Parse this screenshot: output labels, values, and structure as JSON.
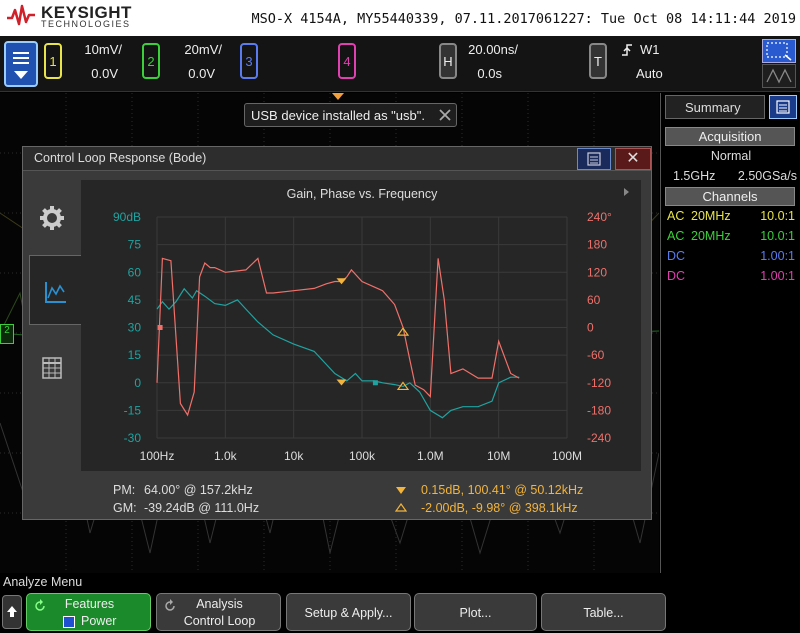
{
  "header": {
    "brand": "KEYSIGHT",
    "brand_sub": "TECHNOLOGIES",
    "instrument": "MSO-X 4154A, MY55440339, 07.11.2017061227: Tue Oct 08 14:11:44 2019"
  },
  "channels": [
    {
      "num": "1",
      "scale": "10mV/",
      "offset": "0.0V",
      "color": "#e8e44a"
    },
    {
      "num": "2",
      "scale": "20mV/",
      "offset": "0.0V",
      "color": "#3ccf3c"
    },
    {
      "num": "3",
      "color": "#5a7cf0"
    },
    {
      "num": "4",
      "color": "#e040b0"
    }
  ],
  "horizontal": {
    "key": "H",
    "scale": "20.00ns/",
    "offset": "0.0s"
  },
  "trigger": {
    "key": "T",
    "source": "W1",
    "mode": "Auto"
  },
  "toast": {
    "message": "USB device installed as \"usb\"."
  },
  "right_panel": {
    "title": "Summary",
    "acquisition_header": "Acquisition",
    "acquisition_mode": "Normal",
    "bandwidth": "1.5GHz",
    "sample_rate": "2.50GSa/s",
    "channels_header": "Channels",
    "channel_rows": [
      {
        "coupling": "AC",
        "bw": "20MHz",
        "probe": "10.0:1",
        "color": "#e8e44a"
      },
      {
        "coupling": "AC",
        "bw": "20MHz",
        "probe": "10.0:1",
        "color": "#3ccf3c"
      },
      {
        "coupling": "DC",
        "bw": "",
        "probe": "1.00:1",
        "color": "#5a7cf0"
      },
      {
        "coupling": "DC",
        "bw": "",
        "probe": "1.00:1",
        "color": "#e040b0"
      }
    ]
  },
  "ground_marker": "2",
  "dialog": {
    "title": "Control Loop Response (Bode)",
    "close_glyph": "✕"
  },
  "chart_data": {
    "type": "line",
    "title": "Gain, Phase vs. Frequency",
    "x_scale": "log",
    "x_ticks": [
      "100Hz",
      "1.0k",
      "10k",
      "100k",
      "1.0M",
      "10M",
      "100M"
    ],
    "y_left_ticks": [
      "90dB",
      "75",
      "60",
      "45",
      "30",
      "15",
      "0",
      "-15",
      "-30"
    ],
    "y_right_ticks": [
      "240°",
      "180",
      "120",
      "60",
      "0",
      "-60",
      "-120",
      "-180",
      "-240"
    ],
    "ylim_left": [
      -30,
      90
    ],
    "ylim_right": [
      -240,
      240
    ],
    "xlim_hz": [
      100,
      100000000
    ],
    "series": [
      {
        "name": "Gain",
        "axis": "left",
        "color": "#1fa3a0",
        "x": [
          100,
          120,
          150,
          190,
          250,
          330,
          380,
          500,
          700,
          1000,
          1500,
          2000,
          3000,
          5000,
          10000,
          20000,
          40000,
          60000,
          80000,
          100000,
          150000,
          200000,
          300000,
          400000,
          500000,
          700000,
          1000000,
          1500000,
          2000000,
          3000000,
          5000000,
          8000000,
          10000000,
          15000000,
          20000000
        ],
        "y": [
          40,
          44,
          40,
          44,
          51,
          46,
          50,
          47,
          43,
          42,
          45,
          40,
          33,
          26,
          21,
          17,
          5,
          1,
          5,
          1,
          1,
          0,
          -1,
          -2,
          0,
          -5,
          -15,
          -19,
          -15,
          -13,
          -13,
          -10,
          0,
          3,
          3
        ]
      },
      {
        "name": "Phase",
        "axis": "right",
        "color": "#f0706a",
        "x": [
          100,
          120,
          160,
          220,
          280,
          350,
          420,
          500,
          600,
          700,
          1000,
          2000,
          3000,
          4000,
          5000,
          10000,
          20000,
          30000,
          40000,
          50120,
          60000,
          70000,
          100000,
          200000,
          300000,
          400000,
          500000,
          600000,
          800000,
          1000000,
          1300000,
          1600000,
          2000000,
          3000000,
          5000000,
          8000000,
          10000000,
          15000000,
          20000000
        ],
        "y": [
          -120,
          150,
          145,
          -165,
          -190,
          -140,
          110,
          140,
          130,
          130,
          120,
          125,
          150,
          75,
          75,
          80,
          85,
          95,
          100,
          100,
          110,
          125,
          100,
          80,
          50,
          0,
          -70,
          -125,
          -135,
          -150,
          150,
          60,
          -100,
          -90,
          -110,
          -110,
          -30,
          -100,
          -110
        ]
      }
    ],
    "markers": [
      {
        "name": "PM",
        "label": "64.00° @ 157.2kHz",
        "x": 157200,
        "y": -120,
        "axis": "right"
      },
      {
        "name": "GM",
        "label": "-39.24dB @ 111.0Hz",
        "x": 111,
        "y": 0,
        "axis": "right"
      },
      {
        "name": "Cursor1",
        "label": "0.15dB, 100.41° @ 50.12kHz",
        "x": 50120,
        "y_gain": 0.15,
        "y_phase": 100.41
      },
      {
        "name": "Cursor2",
        "label": "-2.00dB, -9.98° @ 398.1kHz",
        "x": 398100,
        "y_gain": -2.0,
        "y_phase": -9.98
      }
    ]
  },
  "readouts": {
    "pm_label": "PM:",
    "pm_value": "64.00° @ 157.2kHz",
    "gm_label": "GM:",
    "gm_value": "-39.24dB @ 111.0Hz",
    "cursor1_value": "0.15dB, 100.41° @ 50.12kHz",
    "cursor2_value": "-2.00dB, -9.98° @ 398.1kHz",
    "cursor_color": "#f2b43c"
  },
  "bottom": {
    "menu_title": "Analyze Menu",
    "softkeys": [
      {
        "line1": "Features",
        "line2": "Power"
      },
      {
        "line1": "Analysis",
        "line2": "Control Loop"
      },
      {
        "line1": "Setup & Apply..."
      },
      {
        "line1": "Plot..."
      },
      {
        "line1": "Table..."
      }
    ]
  }
}
